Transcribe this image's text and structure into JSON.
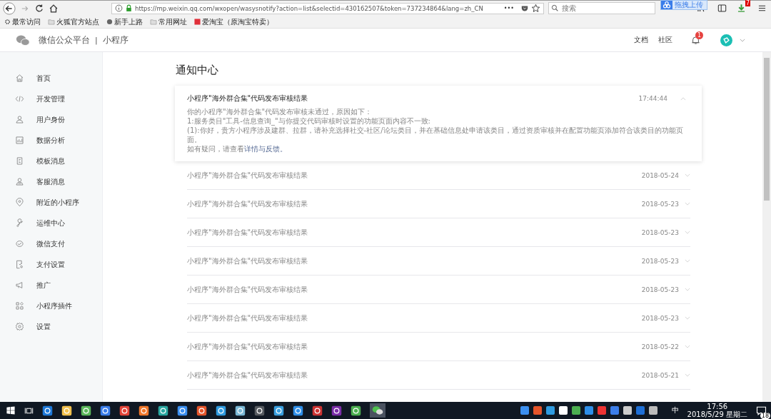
{
  "browser": {
    "url": "https://mp.weixin.qq.com/wxopen/wasysnotify?action=list&selectid=430162507&token=737234864&lang=zh_CN",
    "more": "•••",
    "search": {
      "placeholder": "搜索"
    },
    "upload_tip": "拖拽上传",
    "download_badge": "7",
    "bookmarks": [
      "最常访问",
      "火狐官方站点",
      "新手上路",
      "常用网址",
      "爱淘宝（原淘宝特卖）"
    ]
  },
  "header": {
    "brand": "微信公众平台",
    "separator": "|",
    "product": "小程序",
    "links": [
      "文档",
      "社区"
    ],
    "bell_badge": "1"
  },
  "sidebar": {
    "items": [
      {
        "label": "首页",
        "selected": false
      },
      {
        "label": "开发管理",
        "selected": false
      },
      {
        "label": "用户身份",
        "selected": false
      },
      {
        "label": "数据分析",
        "selected": false
      },
      {
        "label": "模板消息",
        "selected": false
      },
      {
        "label": "客服消息",
        "selected": false
      },
      {
        "label": "附近的小程序",
        "selected": false
      },
      {
        "label": "运维中心",
        "selected": false
      },
      {
        "label": "微信支付",
        "selected": false
      },
      {
        "label": "支付设置",
        "selected": false
      },
      {
        "label": "推广",
        "selected": false
      },
      {
        "label": "小程序插件",
        "selected": false
      },
      {
        "label": "设置",
        "selected": false
      }
    ]
  },
  "page_title": "通知中心",
  "notifications": [
    {
      "title": "小程序\"海外群合集\"代码发布审核结果",
      "time": "17:44:44",
      "expanded": true,
      "body": [
        "你的小程序\"海外群合集\"代码发布审核未通过，原因如下：",
        "1:服务类目\"工具-信息查询_\"与你提交代码审核时设置的功能页面内容不一致:",
        "(1):你好，贵方小程序涉及建群、拉群，请补充选择社交-社区/论坛类目，并在基础信息处申请该类目，通过资质审核并在配置功能页添加符合该类目的功能页面。"
      ],
      "footer": {
        "text": "如有疑问，请查看",
        "link": "详情与反馈。"
      }
    },
    {
      "title": "小程序\"海外群合集\"代码发布审核结果",
      "time": "2018-05-24",
      "expanded": false
    },
    {
      "title": "小程序\"海外群合集\"代码发布审核结果",
      "time": "2018-05-23",
      "expanded": false
    },
    {
      "title": "小程序\"海外群合集\"代码发布审核结果",
      "time": "2018-05-23",
      "expanded": false
    },
    {
      "title": "小程序\"海外群合集\"代码发布审核结果",
      "time": "2018-05-23",
      "expanded": false
    },
    {
      "title": "小程序\"海外群合集\"代码发布审核结果",
      "time": "2018-05-23",
      "expanded": false
    },
    {
      "title": "小程序\"海外群合集\"代码发布审核结果",
      "time": "2018-05-23",
      "expanded": false
    },
    {
      "title": "小程序\"海外群合集\"代码发布审核结果",
      "time": "2018-05-22",
      "expanded": false
    },
    {
      "title": "小程序\"海外群合集\"代码发布审核结果",
      "time": "2018-05-21",
      "expanded": false
    }
  ],
  "taskbar": {
    "input_method": "中",
    "time": "17:56",
    "date": "2018/5/29 星期二",
    "notification_count": "18"
  }
}
